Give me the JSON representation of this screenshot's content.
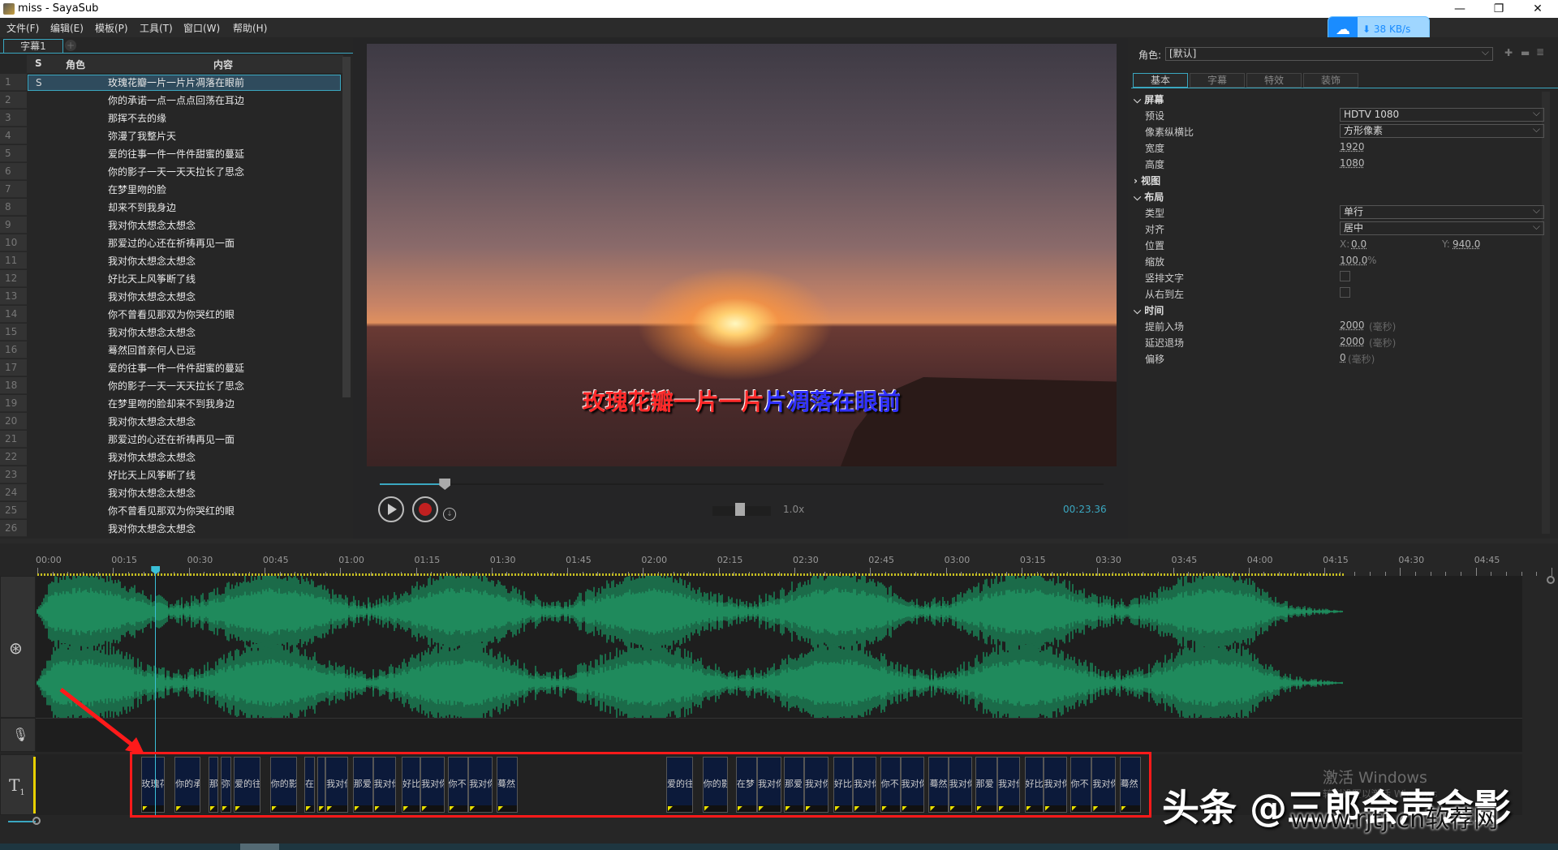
{
  "window": {
    "title": "miss - SayaSub",
    "minimize": "—",
    "restore": "❐",
    "close": "✕"
  },
  "menu": [
    "文件(F)",
    "编辑(E)",
    "模板(P)",
    "工具(T)",
    "窗口(W)",
    "帮助(H)"
  ],
  "netspeed": {
    "icon": "baidu-cloud-icon",
    "value": "⬇ 38 KB/s"
  },
  "doc_tab": "字幕1",
  "list": {
    "headers": {
      "s": "S",
      "role": "角色",
      "content": "内容"
    },
    "selected": 1,
    "rows": [
      {
        "n": "1",
        "s": "S",
        "text": "玫瑰花瓣一片一片片凋落在眼前"
      },
      {
        "n": "2",
        "s": "",
        "text": "你的承诺一点一点点回荡在耳边"
      },
      {
        "n": "3",
        "s": "",
        "text": "那挥不去的缘"
      },
      {
        "n": "4",
        "s": "",
        "text": "弥漫了我整片天"
      },
      {
        "n": "5",
        "s": "",
        "text": "爱的往事一件一件件甜蜜的蔓延"
      },
      {
        "n": "6",
        "s": "",
        "text": "你的影子一天一天天拉长了思念"
      },
      {
        "n": "7",
        "s": "",
        "text": "在梦里吻的脸"
      },
      {
        "n": "8",
        "s": "",
        "text": "却来不到我身边"
      },
      {
        "n": "9",
        "s": "",
        "text": "我对你太想念太想念"
      },
      {
        "n": "10",
        "s": "",
        "text": "那爱过的心还在祈祷再见一面"
      },
      {
        "n": "11",
        "s": "",
        "text": "我对你太想念太想念"
      },
      {
        "n": "12",
        "s": "",
        "text": "好比天上风筝断了线"
      },
      {
        "n": "13",
        "s": "",
        "text": "我对你太想念太想念"
      },
      {
        "n": "14",
        "s": "",
        "text": "你不曾看见那双为你哭红的眼"
      },
      {
        "n": "15",
        "s": "",
        "text": "我对你太想念太想念"
      },
      {
        "n": "16",
        "s": "",
        "text": "蓦然回首亲何人已远"
      },
      {
        "n": "17",
        "s": "",
        "text": "爱的往事一件一件件甜蜜的蔓延"
      },
      {
        "n": "18",
        "s": "",
        "text": "你的影子一天一天天拉长了思念"
      },
      {
        "n": "19",
        "s": "",
        "text": "在梦里吻的脸却来不到我身边"
      },
      {
        "n": "20",
        "s": "",
        "text": "我对你太想念太想念"
      },
      {
        "n": "21",
        "s": "",
        "text": "那爱过的心还在祈祷再见一面"
      },
      {
        "n": "22",
        "s": "",
        "text": "我对你太想念太想念"
      },
      {
        "n": "23",
        "s": "",
        "text": "好比天上风筝断了线"
      },
      {
        "n": "24",
        "s": "",
        "text": "我对你太想念太想念"
      },
      {
        "n": "25",
        "s": "",
        "text": "你不曾看见那双为你哭红的眼"
      },
      {
        "n": "26",
        "s": "",
        "text": "我对你太想念太想念"
      }
    ]
  },
  "player": {
    "karaoke_sung": "玫瑰花瓣一片一片",
    "karaoke_unsung": "片凋落在眼前",
    "progress_fraction": 0.09,
    "speed": "1.0x",
    "time": "00:23.36"
  },
  "properties": {
    "role_label": "角色:",
    "role_value": "[默认]",
    "tabs": [
      "基本",
      "字幕",
      "特效",
      "装饰"
    ],
    "screen": {
      "title": "屏幕",
      "preset_label": "预设",
      "preset": "HDTV 1080",
      "aspect_label": "像素纵横比",
      "aspect": "方形像素",
      "width_label": "宽度",
      "width": "1920",
      "height_label": "高度",
      "height": "1080"
    },
    "view": {
      "title": "视图"
    },
    "layout": {
      "title": "布局",
      "type_label": "类型",
      "type": "单行",
      "align_label": "对齐",
      "align": "居中",
      "pos_label": "位置",
      "x_label": "X:",
      "x": "0.0",
      "y_label": "Y:",
      "y": "940.0",
      "scale_label": "缩放",
      "scale": "100.0",
      "scale_unit": "%",
      "vertical_label": "竖排文字",
      "rtl_label": "从右到左"
    },
    "time": {
      "title": "时间",
      "lead_in_label": "提前入场",
      "lead_in": "2000",
      "delay_out_label": "延迟退场",
      "delay_out": "2000",
      "offset_label": "偏移",
      "offset": "0",
      "unit": "(毫秒)"
    }
  },
  "timeline": {
    "ticks": [
      "00:00",
      "00:15",
      "00:30",
      "00:45",
      "01:00",
      "01:15",
      "01:30",
      "01:45",
      "02:00",
      "02:15",
      "02:30",
      "02:45",
      "03:00",
      "03:15",
      "03:30",
      "03:45",
      "04:00",
      "04:15",
      "04:30",
      "04:45"
    ],
    "playhead_seconds": 23.36,
    "audio_end_seconds": 259,
    "blocks": [
      {
        "t": "玫瑰花",
        "s": 20.5,
        "e": 25.3
      },
      {
        "t": "你的承",
        "s": 27.2,
        "e": 32.3
      },
      {
        "t": "那",
        "s": 33.9,
        "e": 35.8
      },
      {
        "t": "弥",
        "s": 36.3,
        "e": 38.4
      },
      {
        "t": "爱的往",
        "s": 38.9,
        "e": 44.2
      },
      {
        "t": "你的影",
        "s": 46.1,
        "e": 51.4
      },
      {
        "t": "在",
        "s": 52.9,
        "e": 55
      },
      {
        "t": "",
        "s": 55.5,
        "e": 57.1
      },
      {
        "t": "我对你",
        "s": 57.1,
        "e": 61.6
      },
      {
        "t": "那爱",
        "s": 62.5,
        "e": 66.5
      },
      {
        "t": "我对你",
        "s": 66.5,
        "e": 71
      },
      {
        "t": "好比",
        "s": 72.2,
        "e": 75.9
      },
      {
        "t": "我对你",
        "s": 75.9,
        "e": 80.7
      },
      {
        "t": "你不",
        "s": 81.3,
        "e": 85.4
      },
      {
        "t": "我对你",
        "s": 85.4,
        "e": 90.2
      },
      {
        "t": "蓦然",
        "s": 91,
        "e": 95.2
      },
      {
        "t": "爱的往",
        "s": 124.6,
        "e": 129.9
      },
      {
        "t": "你的影",
        "s": 131.8,
        "e": 136.8
      },
      {
        "t": "在梦",
        "s": 138.4,
        "e": 142.6
      },
      {
        "t": "我对你",
        "s": 142.6,
        "e": 147.4
      },
      {
        "t": "那爱",
        "s": 147.9,
        "e": 151.9
      },
      {
        "t": "我对你",
        "s": 151.9,
        "e": 156.7
      },
      {
        "t": "好比",
        "s": 157.7,
        "e": 161.6
      },
      {
        "t": "我对你",
        "s": 161.6,
        "e": 166.2
      },
      {
        "t": "你不",
        "s": 167,
        "e": 171
      },
      {
        "t": "我对你",
        "s": 171,
        "e": 175.7
      },
      {
        "t": "蓦然",
        "s": 176.6,
        "e": 180.5
      },
      {
        "t": "我对你",
        "s": 180.5,
        "e": 185.2
      },
      {
        "t": "那爱",
        "s": 185.8,
        "e": 190.2
      },
      {
        "t": "我对你",
        "s": 190.2,
        "e": 194.7
      },
      {
        "t": "好比",
        "s": 195.6,
        "e": 199.3
      },
      {
        "t": "我对你",
        "s": 199.3,
        "e": 204.1
      },
      {
        "t": "你不",
        "s": 204.6,
        "e": 208.9
      },
      {
        "t": "我对你",
        "s": 208.9,
        "e": 213.6
      },
      {
        "t": "蓦然",
        "s": 214.4,
        "e": 218.6
      }
    ]
  },
  "overlays": {
    "activate_windows": "激活 Windows",
    "activate_sub": "转到设置以激活 Windows",
    "toutiao": "头条 @三郎会声会影",
    "rjtj": "www.rjtj.cn软荐网"
  }
}
